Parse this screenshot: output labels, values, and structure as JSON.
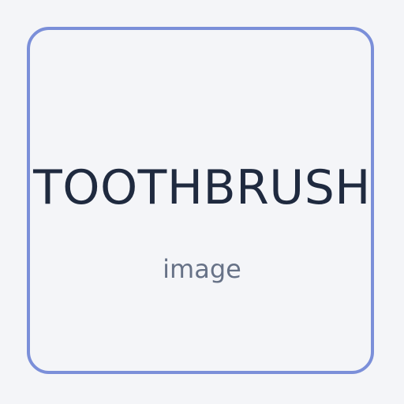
{
  "card": {
    "title": "TOOTHBRUSH",
    "subtitle": "image"
  },
  "colors": {
    "background": "#f4f5f8",
    "border": "#7b8fd9",
    "title": "#1f2a3f",
    "subtitle": "#677287"
  }
}
